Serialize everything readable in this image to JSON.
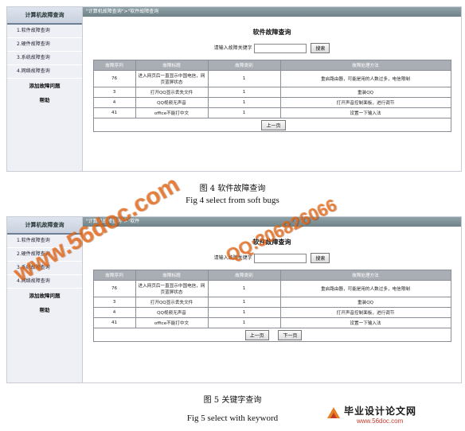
{
  "sidebar": {
    "header": "计算机故障查询",
    "items": [
      "1.软件故障查询",
      "2.硬件故障查询",
      "3.系统故障查询",
      "4.网络故障查询"
    ],
    "add_label": "添加故障问题",
    "help_label": "帮助"
  },
  "shot1": {
    "breadcrumb": "\"计算机故障查询\">\"软件故障查询",
    "page_title": "软件故障查询",
    "search_label": "请输入故障关键字",
    "search_value": "",
    "search_button": "搜索",
    "columns": [
      "故障序列",
      "故障标题",
      "故障类别",
      "故障处理方法"
    ],
    "rows": [
      [
        "76",
        "进入网页后一直显示中国电信，网页蓝屏状态",
        "1",
        "重启路由器，可能是用的人数过多，电信限制"
      ],
      [
        "3",
        "打开QQ显示丢失文件",
        "1",
        "重装QQ"
      ],
      [
        "4",
        "QQ视频无声音",
        "1",
        "打开声音控制面板，进行调节"
      ],
      [
        "41",
        "office不能打中文",
        "1",
        "设置一下输入法"
      ]
    ],
    "prev_button": "上一页"
  },
  "caption1": {
    "cn": "图 4  软件故障查询",
    "en": "Fig 4   select from soft bugs"
  },
  "shot2": {
    "breadcrumb": "\"计算机故障查询\">\"软件",
    "page_title": "软件故障查询",
    "search_label": "请输入故障关键字",
    "search_value": "",
    "search_button": "搜索",
    "columns": [
      "故障序列",
      "故障标题",
      "故障类别",
      "故障处理方法"
    ],
    "rows": [
      [
        "76",
        "进入网页后一直显示中国电信，网页蓝屏状态",
        "1",
        "重启路由器，可能是用的人数过多，电信限制"
      ],
      [
        "3",
        "打开QQ显示丢失文件",
        "1",
        "重装QQ"
      ],
      [
        "4",
        "QQ视频无声音",
        "1",
        "打开声音控制面板，进行调节"
      ],
      [
        "41",
        "office不能打中文",
        "1",
        "设置一下输入法"
      ]
    ],
    "prev_button": "上一页",
    "next_button": "下一页"
  },
  "caption2": {
    "cn": "图 5  关键字查询",
    "en": "Fig 5    select with keyword"
  },
  "watermark": {
    "site": "www.56doc.com",
    "qq": "QQ:306826066"
  },
  "logo": {
    "title": "毕业设计论文网",
    "url": "www.56doc.com"
  }
}
